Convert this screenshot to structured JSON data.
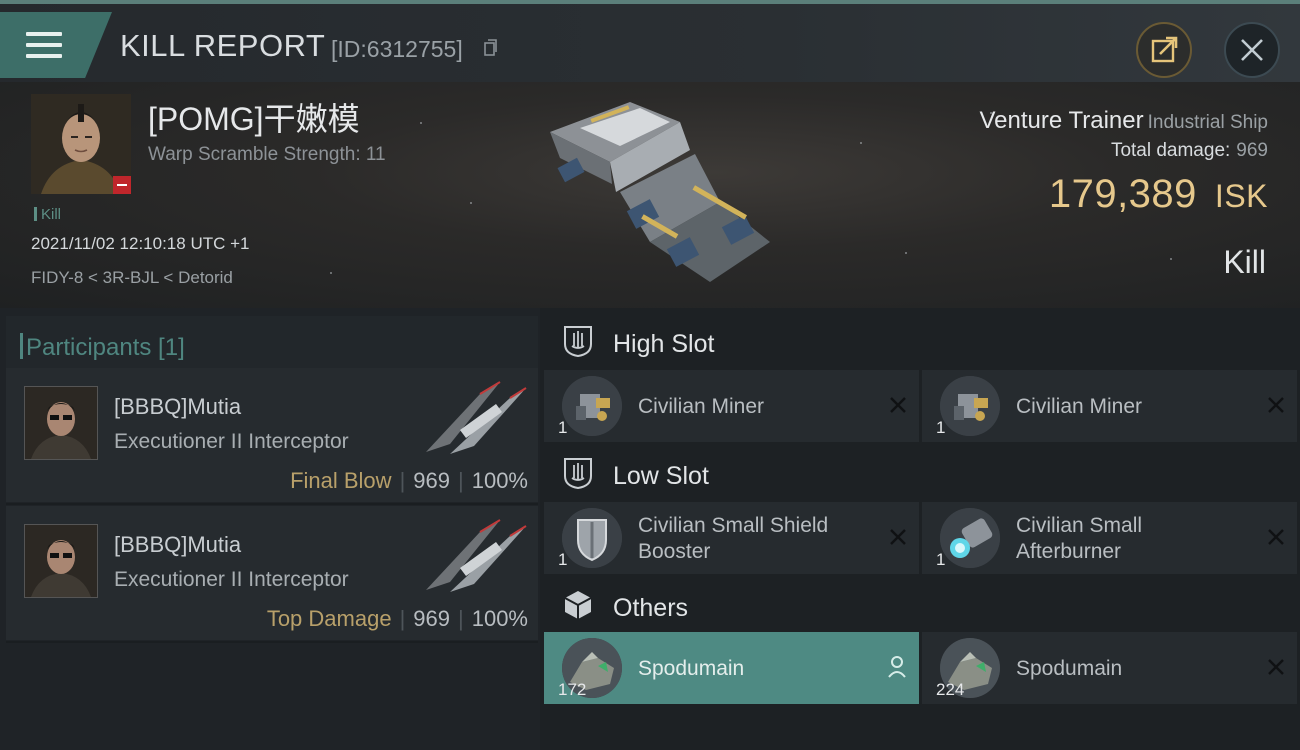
{
  "header": {
    "title": "KILL REPORT",
    "report_id": "[ID:6312755]"
  },
  "victim": {
    "name": "[POMG]干嫩模",
    "scram_label": "Warp Scramble Strength: 11",
    "kill_tag": "Kill",
    "datetime": "2021/11/02 12:10:18 UTC +1",
    "location": "FIDY-8 < 3R-BJL < Detorid"
  },
  "ship": {
    "name": "Venture Trainer",
    "class": "Industrial Ship",
    "damage_label": "Total damage:",
    "damage_value": "969",
    "isk_value": "179,389",
    "isk_unit": "ISK",
    "result": "Kill"
  },
  "participants": {
    "label": "Participants [1]",
    "rows": [
      {
        "name": "[BBBQ]Mutia",
        "ship": "Executioner II Interceptor",
        "tag": "Final Blow",
        "damage": "969",
        "percent": "100%"
      },
      {
        "name": "[BBBQ]Mutia",
        "ship": "Executioner II Interceptor",
        "tag": "Top Damage",
        "damage": "969",
        "percent": "100%"
      }
    ]
  },
  "slots": {
    "high": {
      "label": "High Slot",
      "items": [
        {
          "name": "Civilian Miner",
          "qty": "1"
        },
        {
          "name": "Civilian Miner",
          "qty": "1"
        }
      ]
    },
    "low": {
      "label": "Low Slot",
      "items": [
        {
          "name_line1": "Civilian Small Shield",
          "name_line2": "Booster",
          "qty": "1"
        },
        {
          "name_line1": "Civilian Small",
          "name_line2": "Afterburner",
          "qty": "1"
        }
      ]
    },
    "others": {
      "label": "Others",
      "items": [
        {
          "name": "Spodumain",
          "qty": "172"
        },
        {
          "name": "Spodumain",
          "qty": "224"
        }
      ]
    }
  },
  "colors": {
    "accent_teal": "#4e8a83",
    "isk_gold": "#e6c88c",
    "badge_red": "#c0262b"
  }
}
